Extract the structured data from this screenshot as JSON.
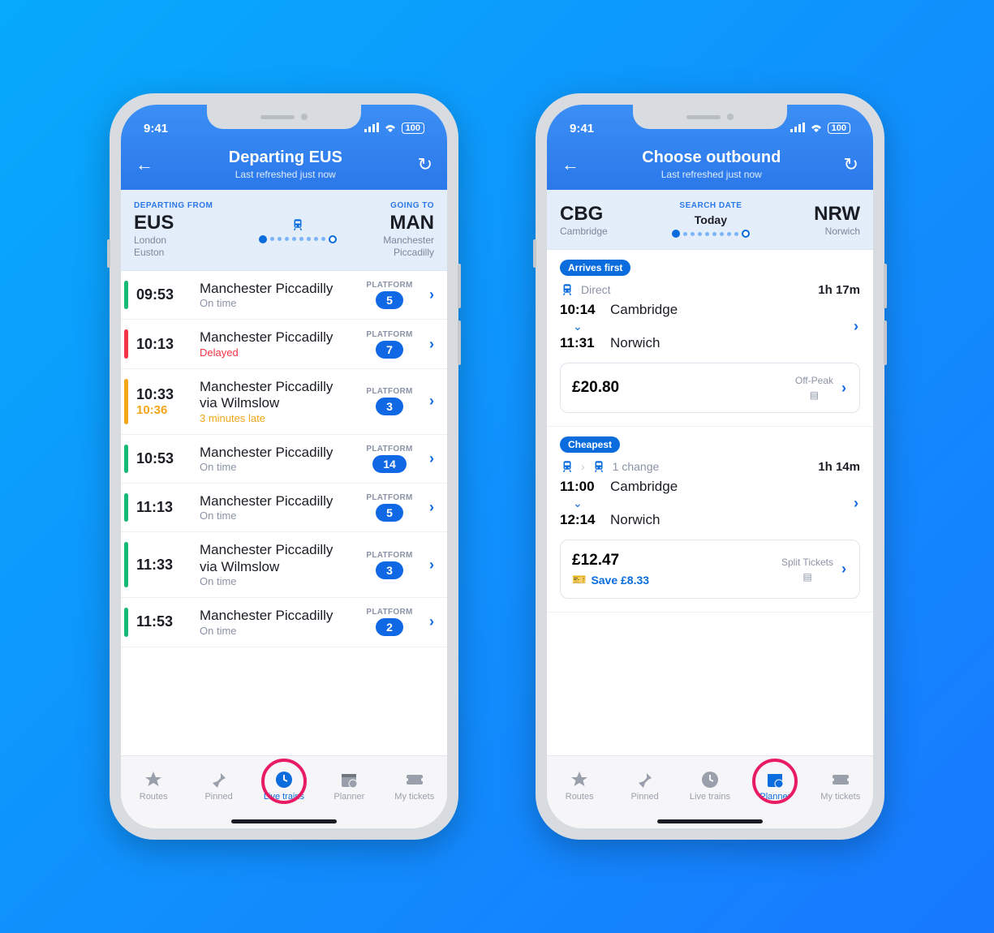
{
  "status_time": "9:41",
  "battery": "100",
  "left_phone": {
    "title": "Departing EUS",
    "subtitle": "Last refreshed just now",
    "from_label": "DEPARTING FROM",
    "to_label": "GOING TO",
    "from_code": "EUS",
    "from_name": "London\nEuston",
    "to_code": "MAN",
    "to_name": "Manchester\nPiccadilly",
    "platform_label": "PLATFORM",
    "rows": [
      {
        "time": "09:53",
        "dest": "Manchester Piccadilly",
        "status": "On time",
        "stripe": "green",
        "platform": "5"
      },
      {
        "time": "10:13",
        "dest": "Manchester Piccadilly",
        "status": "Delayed",
        "stripe": "red",
        "platform": "7"
      },
      {
        "time": "10:33",
        "time2": "10:36",
        "dest": "Manchester Piccadilly via Wilmslow",
        "status": "3 minutes late",
        "stripe": "amber",
        "platform": "3"
      },
      {
        "time": "10:53",
        "dest": "Manchester Piccadilly",
        "status": "On time",
        "stripe": "green",
        "platform": "14"
      },
      {
        "time": "11:13",
        "dest": "Manchester Piccadilly",
        "status": "On time",
        "stripe": "green",
        "platform": "5"
      },
      {
        "time": "11:33",
        "dest": "Manchester Piccadilly via Wilmslow",
        "status": "On time",
        "stripe": "green",
        "platform": "3"
      },
      {
        "time": "11:53",
        "dest": "Manchester Piccadilly",
        "status": "On time",
        "stripe": "green",
        "platform": "2"
      }
    ]
  },
  "right_phone": {
    "title": "Choose outbound",
    "subtitle": "Last refreshed just now",
    "search_date_label": "SEARCH DATE",
    "search_date": "Today",
    "from_code": "CBG",
    "from_name": "Cambridge",
    "to_code": "NRW",
    "to_name": "Norwich",
    "journeys": [
      {
        "badge": "Arrives first",
        "changes": "Direct",
        "duration": "1h 17m",
        "dep_time": "10:14",
        "dep_name": "Cambridge",
        "arr_time": "11:31",
        "arr_name": "Norwich",
        "price": "£20.80",
        "fare_type": "Off-Peak",
        "save": ""
      },
      {
        "badge": "Cheapest",
        "changes": "1 change",
        "duration": "1h 14m",
        "dep_time": "11:00",
        "dep_name": "Cambridge",
        "arr_time": "12:14",
        "arr_name": "Norwich",
        "price": "£12.47",
        "fare_type": "Split Tickets",
        "save": "Save £8.33"
      }
    ]
  },
  "tabs": {
    "routes": "Routes",
    "pinned": "Pinned",
    "live": "Live trains",
    "planner": "Planner",
    "tickets": "My tickets"
  }
}
